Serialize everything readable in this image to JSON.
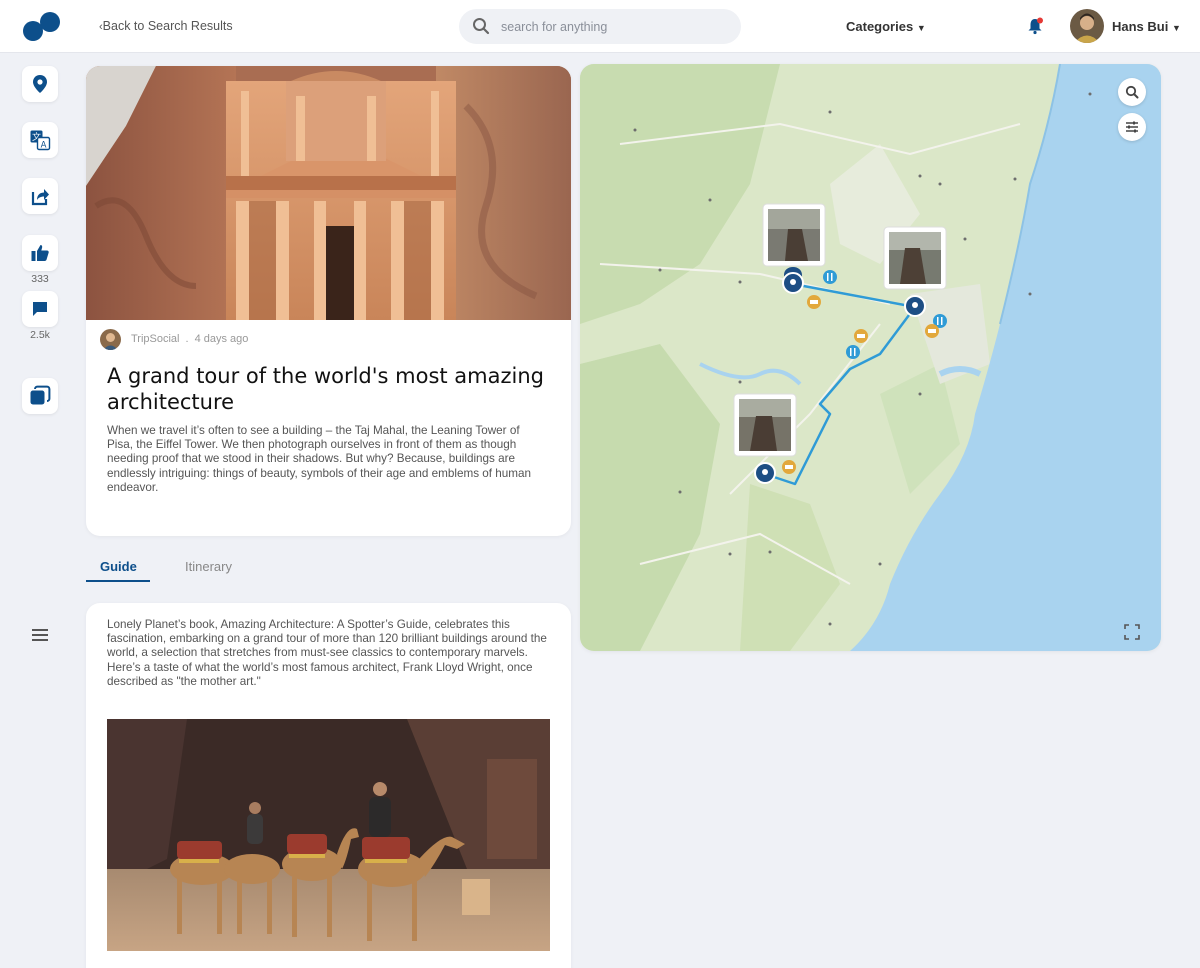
{
  "header": {
    "back_label": "Back to Search Results",
    "search_placeholder": "search for anything",
    "categories_label": "Categories",
    "username": "Hans Bui"
  },
  "sidebar": {
    "likes_count": "333",
    "comments_count": "2.5k"
  },
  "post": {
    "author": "TripSocial",
    "separator": ".",
    "time": "4 days ago",
    "title": "A grand tour of the world's most amazing architecture",
    "body": "When we travel it’s often to see a building – the Taj Mahal, the Leaning Tower of Pisa, the Eiffel Tower. We then photograph ourselves in front of them as though needing proof that we stood in their shadows. But why? Because, buildings are endlessly intriguing: things of beauty, symbols of their age and emblems of human endeavor."
  },
  "tabs": {
    "guide": "Guide",
    "itinerary": "Itinerary",
    "active": "Guide"
  },
  "guide": {
    "text": "Lonely Planet’s book, Amazing Architecture: A Spotter’s Guide, celebrates this fascination, embarking on a grand tour of more than 120 brilliant buildings around the world, a selection that stretches from must-see classics to contemporary marvels. Here’s a taste of what the world’s most famous architect, Frank Lloyd Wright, once described as \"the mother art.\""
  },
  "colors": {
    "brand": "#0d4f8b",
    "accent_blue": "#2f9bd6",
    "poi_orange": "#e2a83c",
    "notification": "#e53935"
  }
}
